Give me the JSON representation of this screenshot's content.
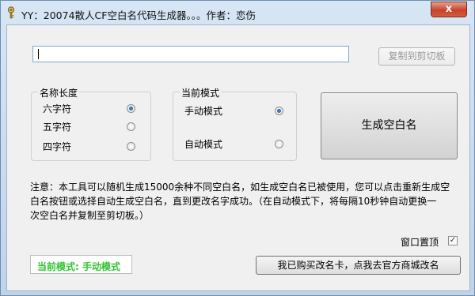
{
  "window": {
    "title": "YY：20074散人CF空白名代码生成器。。。作者：恋伤",
    "close_glyph": "x"
  },
  "input": {
    "value": ""
  },
  "copy_button": {
    "label": "复制到剪切板",
    "enabled": false
  },
  "name_length_group": {
    "title": "名称长度",
    "options": [
      {
        "label": "六字符",
        "selected": true
      },
      {
        "label": "五字符",
        "selected": false
      },
      {
        "label": "四字符",
        "selected": false
      }
    ]
  },
  "mode_group": {
    "title": "当前模式",
    "options": [
      {
        "label": "手动模式",
        "selected": true
      },
      {
        "label": "自动模式",
        "selected": false
      }
    ]
  },
  "generate_button": {
    "label": "生成空白名"
  },
  "notice": {
    "line1": "注意：本工具可以随机生成15000余种不同空白名，如生成空白名已被使用，您可以点击重新生成空",
    "line2": "白名按钮或选择自动生成空白名，直到更改名字成功。（在自动模式下，将每隔10秒钟自动更换一",
    "line3": "次空白名并复制至剪切板。）"
  },
  "topmost": {
    "label": "窗口置顶",
    "checked": true,
    "check_glyph": "✓"
  },
  "status": {
    "text": "当前模式: 手动模式",
    "color": "#31c431"
  },
  "buy_button": {
    "label": "我已购买改名卡，点我去官方商城改名"
  }
}
